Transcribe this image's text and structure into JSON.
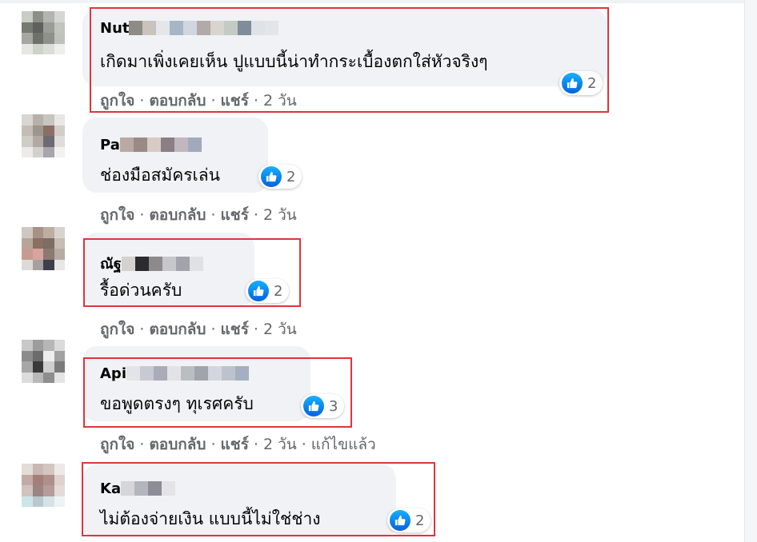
{
  "comments": [
    {
      "author_visible": "Nut",
      "text": "เกิดมาเพิ่งเคยเห็น ปูแบบนี้น่าทำกระเบื้องตกใส่หัวจริงๆ",
      "reaction_count": "2",
      "actions": {
        "like": "ถูกใจ",
        "reply": "ตอบกลับ",
        "share": "แชร์",
        "time": "2 วัน"
      }
    },
    {
      "author_visible": "Pa",
      "text": "ช่องมือสมัครเล่น",
      "reaction_count": "2",
      "actions": {
        "like": "ถูกใจ",
        "reply": "ตอบกลับ",
        "share": "แชร์",
        "time": "2 วัน"
      }
    },
    {
      "author_visible": "ณัฐ",
      "text": "รื้อด่วนครับ",
      "reaction_count": "2",
      "actions": {
        "like": "ถูกใจ",
        "reply": "ตอบกลับ",
        "share": "แชร์",
        "time": "2 วัน"
      }
    },
    {
      "author_visible": "Api",
      "text": "ขอพูดตรงๆ ทุเรศครับ",
      "reaction_count": "3",
      "actions": {
        "like": "ถูกใจ",
        "reply": "ตอบกลับ",
        "share": "แชร์",
        "time": "2 วัน",
        "edited": "แก้ไขแล้ว"
      }
    },
    {
      "author_visible": "Ka",
      "text": "ไม่ต้องจ่ายเงิน แบบนี้ไม่ใช่ช่าง",
      "reaction_count": "2"
    }
  ],
  "colors": {
    "bubble": "#f0f2f5",
    "highlight": "#e0343d",
    "like_blue": "#1877f2",
    "secondary_text": "#65676b"
  },
  "icons": {
    "reaction": "thumbs-up-icon"
  }
}
